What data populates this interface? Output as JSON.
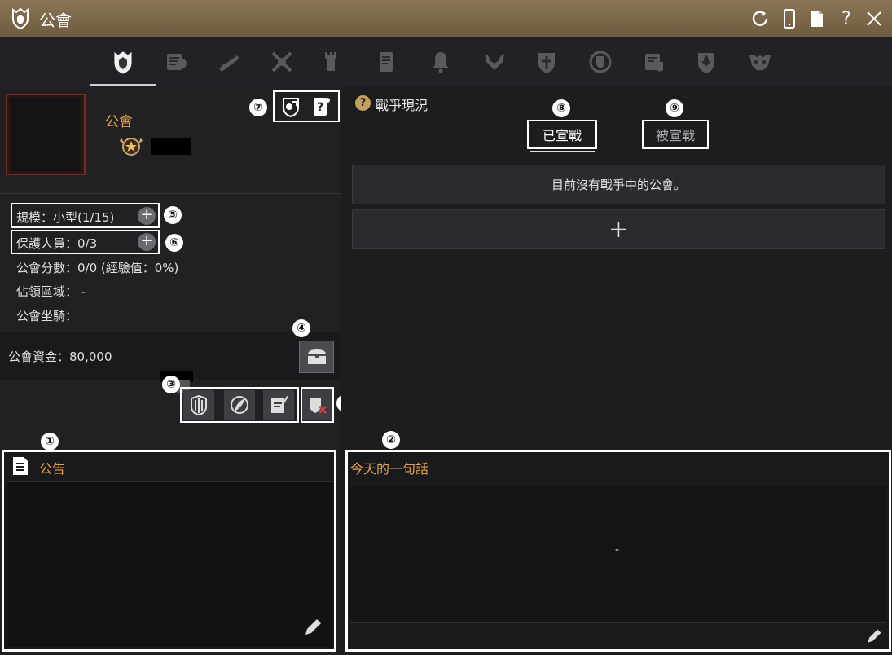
{
  "window": {
    "title": "公會"
  },
  "tabs": [
    {
      "icon": "guild-shield-icon",
      "active": true
    },
    {
      "icon": "member-scroll-icon"
    },
    {
      "icon": "telescope-icon"
    },
    {
      "icon": "crossed-weapons-icon"
    },
    {
      "icon": "tower-icon"
    },
    {
      "icon": "quest-scroll-icon"
    },
    {
      "icon": "bell-icon"
    },
    {
      "icon": "battle-axes-icon"
    },
    {
      "icon": "shield-cross-icon"
    },
    {
      "icon": "laurel-shield-icon"
    },
    {
      "icon": "contract-scroll-icon"
    },
    {
      "icon": "fleur-shield-icon"
    },
    {
      "icon": "mask-icon"
    }
  ],
  "guild": {
    "name": "公會",
    "stats": {
      "scale": "規模：小型(1/15)",
      "guards": "保護人員：0/3",
      "score": "公會分數：0/0 (經驗值：0%)",
      "territory": "佔領區域： -",
      "mount": "公會坐騎："
    },
    "funds": "公會資金：80,000"
  },
  "badges": {
    "b1": "①",
    "b2": "②",
    "b3": "③",
    "b4": "④",
    "b5": "⑤",
    "b6": "⑥",
    "b7": "⑦",
    "b8": "⑧",
    "b9": "⑨",
    "b10": "⑩"
  },
  "notice": {
    "title": "公告"
  },
  "war": {
    "title": "戰爭現況",
    "tab_declared": "已宣戰",
    "tab_received": "被宣戰",
    "empty_message": "目前沒有戰爭中的公會。",
    "add_label": "+"
  },
  "motto": {
    "title": "今天的一句話",
    "text": "-"
  },
  "colors": {
    "accent": "#e8a24a",
    "titlebar": "#7a6648",
    "emblem_border": "#7a2a22"
  }
}
